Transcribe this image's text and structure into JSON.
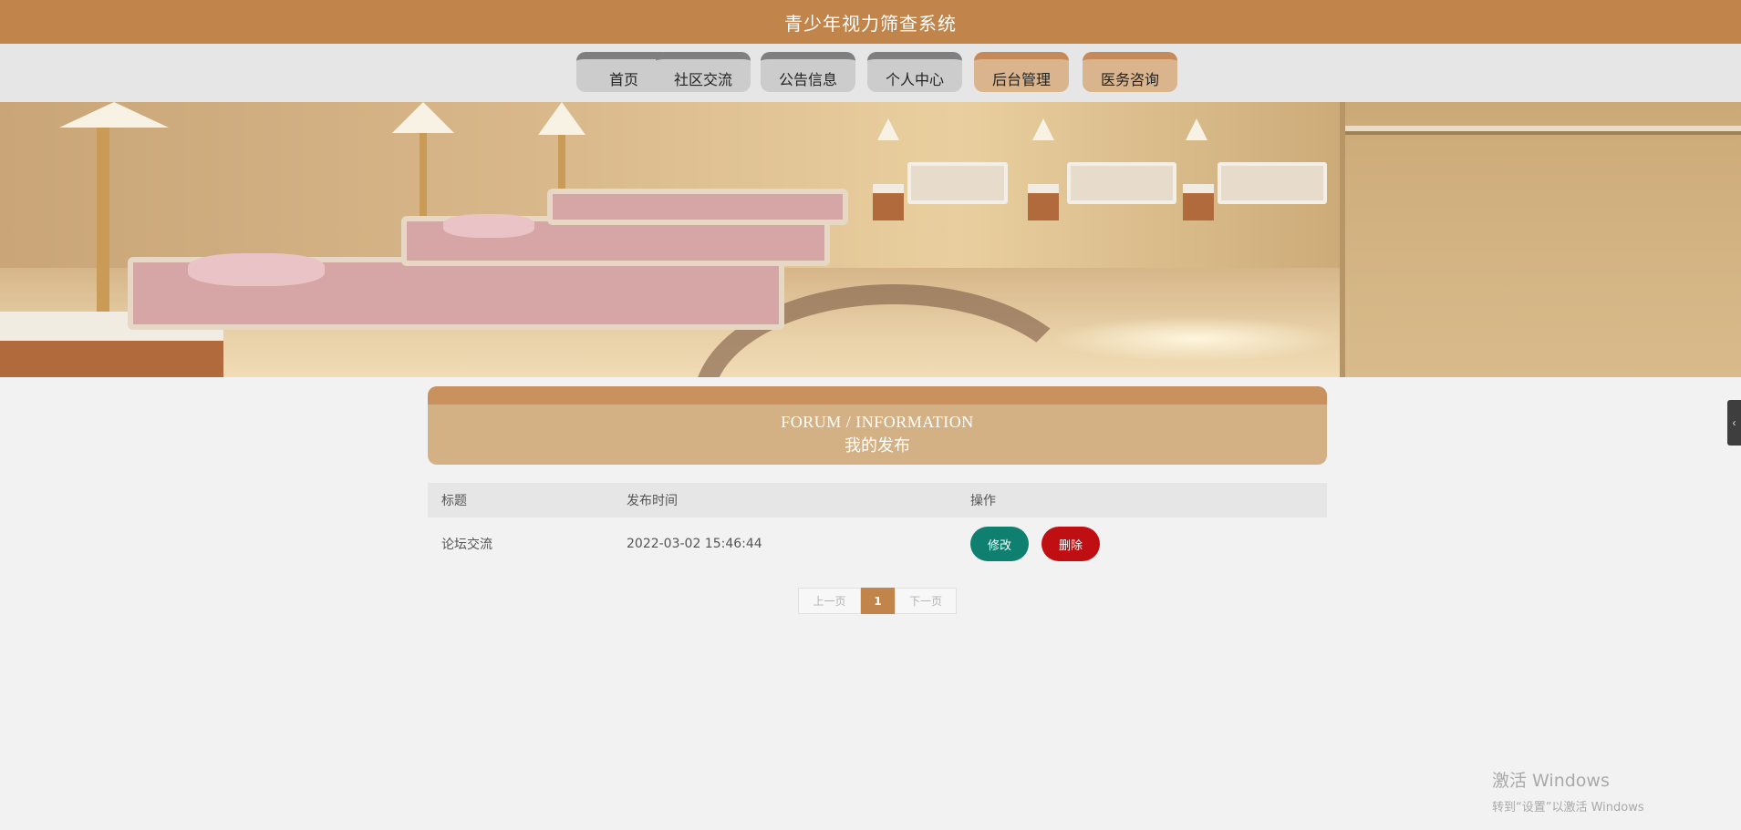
{
  "app": {
    "title": "青少年视力筛查系统"
  },
  "nav": {
    "items": [
      {
        "label": "首页"
      },
      {
        "label": "社区交流"
      },
      {
        "label": "公告信息"
      },
      {
        "label": "个人中心"
      },
      {
        "label": "后台管理"
      },
      {
        "label": "医务咨询"
      }
    ]
  },
  "banner": {
    "image_subject": "hospital-ward-beds"
  },
  "section": {
    "title_en": "FORUM / INFORMATION",
    "title_cn": "我的发布"
  },
  "table": {
    "headers": {
      "title": "标题",
      "time": "发布时间",
      "ops": "操作"
    },
    "rows": [
      {
        "title": "论坛交流",
        "time": "2022-03-02 15:46:44",
        "edit_label": "修改",
        "delete_label": "删除"
      }
    ]
  },
  "pagination": {
    "prev": "上一页",
    "current": "1",
    "next": "下一页"
  },
  "side_tab": {
    "glyph": "‹"
  },
  "watermark": {
    "line1": "激活 Windows",
    "line2": "转到“设置”以激活 Windows"
  },
  "colors": {
    "header": "#c1844a",
    "nav_gray": "#cccccc",
    "nav_tan": "#d9b48c",
    "edit_button": "#0f7f6f",
    "delete_button": "#bf0f13"
  }
}
